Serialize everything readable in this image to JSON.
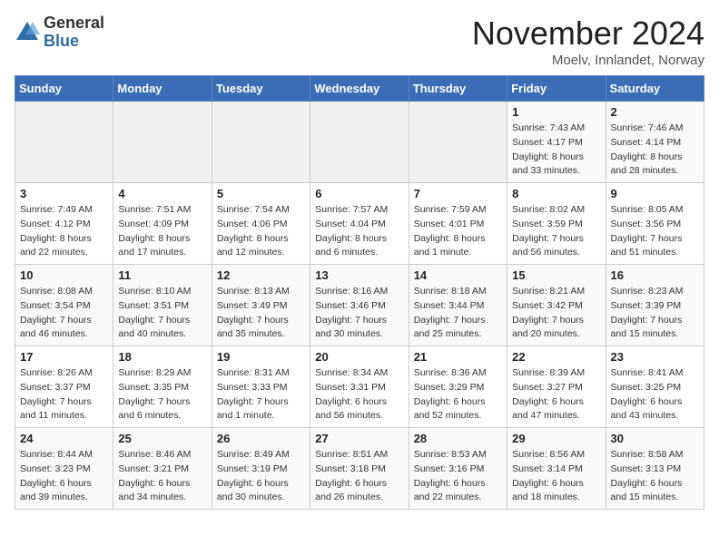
{
  "header": {
    "logo_general": "General",
    "logo_blue": "Blue",
    "month_title": "November 2024",
    "location": "Moelv, Innlandet, Norway"
  },
  "weekdays": [
    "Sunday",
    "Monday",
    "Tuesday",
    "Wednesday",
    "Thursday",
    "Friday",
    "Saturday"
  ],
  "weeks": [
    [
      {
        "day": "",
        "detail": ""
      },
      {
        "day": "",
        "detail": ""
      },
      {
        "day": "",
        "detail": ""
      },
      {
        "day": "",
        "detail": ""
      },
      {
        "day": "",
        "detail": ""
      },
      {
        "day": "1",
        "detail": "Sunrise: 7:43 AM\nSunset: 4:17 PM\nDaylight: 8 hours\nand 33 minutes."
      },
      {
        "day": "2",
        "detail": "Sunrise: 7:46 AM\nSunset: 4:14 PM\nDaylight: 8 hours\nand 28 minutes."
      }
    ],
    [
      {
        "day": "3",
        "detail": "Sunrise: 7:49 AM\nSunset: 4:12 PM\nDaylight: 8 hours\nand 22 minutes."
      },
      {
        "day": "4",
        "detail": "Sunrise: 7:51 AM\nSunset: 4:09 PM\nDaylight: 8 hours\nand 17 minutes."
      },
      {
        "day": "5",
        "detail": "Sunrise: 7:54 AM\nSunset: 4:06 PM\nDaylight: 8 hours\nand 12 minutes."
      },
      {
        "day": "6",
        "detail": "Sunrise: 7:57 AM\nSunset: 4:04 PM\nDaylight: 8 hours\nand 6 minutes."
      },
      {
        "day": "7",
        "detail": "Sunrise: 7:59 AM\nSunset: 4:01 PM\nDaylight: 8 hours\nand 1 minute."
      },
      {
        "day": "8",
        "detail": "Sunrise: 8:02 AM\nSunset: 3:59 PM\nDaylight: 7 hours\nand 56 minutes."
      },
      {
        "day": "9",
        "detail": "Sunrise: 8:05 AM\nSunset: 3:56 PM\nDaylight: 7 hours\nand 51 minutes."
      }
    ],
    [
      {
        "day": "10",
        "detail": "Sunrise: 8:08 AM\nSunset: 3:54 PM\nDaylight: 7 hours\nand 46 minutes."
      },
      {
        "day": "11",
        "detail": "Sunrise: 8:10 AM\nSunset: 3:51 PM\nDaylight: 7 hours\nand 40 minutes."
      },
      {
        "day": "12",
        "detail": "Sunrise: 8:13 AM\nSunset: 3:49 PM\nDaylight: 7 hours\nand 35 minutes."
      },
      {
        "day": "13",
        "detail": "Sunrise: 8:16 AM\nSunset: 3:46 PM\nDaylight: 7 hours\nand 30 minutes."
      },
      {
        "day": "14",
        "detail": "Sunrise: 8:18 AM\nSunset: 3:44 PM\nDaylight: 7 hours\nand 25 minutes."
      },
      {
        "day": "15",
        "detail": "Sunrise: 8:21 AM\nSunset: 3:42 PM\nDaylight: 7 hours\nand 20 minutes."
      },
      {
        "day": "16",
        "detail": "Sunrise: 8:23 AM\nSunset: 3:39 PM\nDaylight: 7 hours\nand 15 minutes."
      }
    ],
    [
      {
        "day": "17",
        "detail": "Sunrise: 8:26 AM\nSunset: 3:37 PM\nDaylight: 7 hours\nand 11 minutes."
      },
      {
        "day": "18",
        "detail": "Sunrise: 8:29 AM\nSunset: 3:35 PM\nDaylight: 7 hours\nand 6 minutes."
      },
      {
        "day": "19",
        "detail": "Sunrise: 8:31 AM\nSunset: 3:33 PM\nDaylight: 7 hours\nand 1 minute."
      },
      {
        "day": "20",
        "detail": "Sunrise: 8:34 AM\nSunset: 3:31 PM\nDaylight: 6 hours\nand 56 minutes."
      },
      {
        "day": "21",
        "detail": "Sunrise: 8:36 AM\nSunset: 3:29 PM\nDaylight: 6 hours\nand 52 minutes."
      },
      {
        "day": "22",
        "detail": "Sunrise: 8:39 AM\nSunset: 3:27 PM\nDaylight: 6 hours\nand 47 minutes."
      },
      {
        "day": "23",
        "detail": "Sunrise: 8:41 AM\nSunset: 3:25 PM\nDaylight: 6 hours\nand 43 minutes."
      }
    ],
    [
      {
        "day": "24",
        "detail": "Sunrise: 8:44 AM\nSunset: 3:23 PM\nDaylight: 6 hours\nand 39 minutes."
      },
      {
        "day": "25",
        "detail": "Sunrise: 8:46 AM\nSunset: 3:21 PM\nDaylight: 6 hours\nand 34 minutes."
      },
      {
        "day": "26",
        "detail": "Sunrise: 8:49 AM\nSunset: 3:19 PM\nDaylight: 6 hours\nand 30 minutes."
      },
      {
        "day": "27",
        "detail": "Sunrise: 8:51 AM\nSunset: 3:18 PM\nDaylight: 6 hours\nand 26 minutes."
      },
      {
        "day": "28",
        "detail": "Sunrise: 8:53 AM\nSunset: 3:16 PM\nDaylight: 6 hours\nand 22 minutes."
      },
      {
        "day": "29",
        "detail": "Sunrise: 8:56 AM\nSunset: 3:14 PM\nDaylight: 6 hours\nand 18 minutes."
      },
      {
        "day": "30",
        "detail": "Sunrise: 8:58 AM\nSunset: 3:13 PM\nDaylight: 6 hours\nand 15 minutes."
      }
    ]
  ]
}
